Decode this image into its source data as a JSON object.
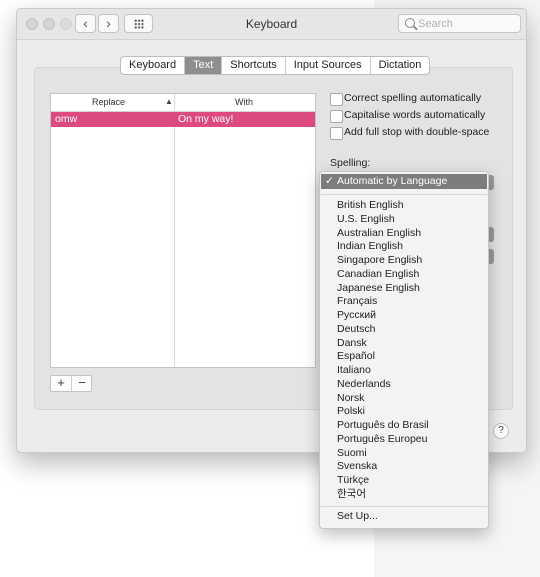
{
  "window": {
    "title": "Keyboard",
    "search_placeholder": "Search"
  },
  "tabs": [
    "Keyboard",
    "Text",
    "Shortcuts",
    "Input Sources",
    "Dictation"
  ],
  "selected_tab": "Text",
  "table": {
    "col_replace": "Replace",
    "col_with": "With",
    "rows": [
      {
        "replace": "omw",
        "with": "On my way!"
      }
    ]
  },
  "buttons": {
    "add": "+",
    "remove": "−",
    "help": "?"
  },
  "options": [
    {
      "label": "Correct spelling automatically",
      "checked": false
    },
    {
      "label": "Capitalise words automatically",
      "checked": false
    },
    {
      "label": "Add full stop with double-space",
      "checked": false
    }
  ],
  "spelling": {
    "label": "Spelling:",
    "selected": "Automatic by Language",
    "languages": [
      "British English",
      "U.S. English",
      "Australian English",
      "Indian English",
      "Singapore English",
      "Canadian English",
      "Japanese English",
      "Français",
      "Русский",
      "Deutsch",
      "Dansk",
      "Español",
      "Italiano",
      "Nederlands",
      "Norsk",
      "Polski",
      "Português do Brasil",
      "Português Europeu",
      "Suomi",
      "Svenska",
      "Türkçe",
      "한국어"
    ],
    "setup": "Set Up..."
  },
  "colors": {
    "selection": "#dd4a82",
    "menu_highlight": "#7d7d7d"
  }
}
